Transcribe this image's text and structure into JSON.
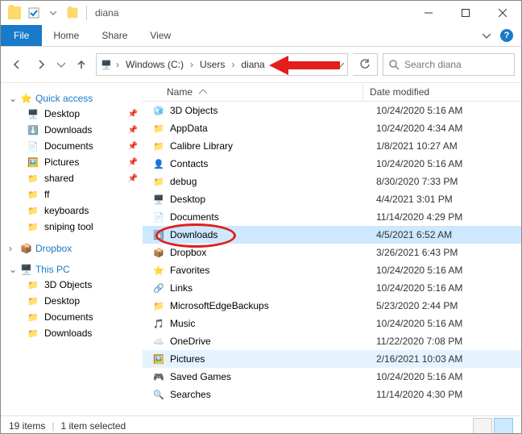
{
  "titlebar": {
    "title": "diana"
  },
  "ribbon": {
    "file": "File",
    "tabs": [
      "Home",
      "Share",
      "View"
    ]
  },
  "breadcrumbs": [
    "Windows (C:)",
    "Users",
    "diana"
  ],
  "search": {
    "placeholder": "Search diana"
  },
  "sidebar": {
    "quick_access": {
      "label": "Quick access",
      "items": [
        {
          "label": "Desktop",
          "pinned": true,
          "icon": "desktop"
        },
        {
          "label": "Downloads",
          "pinned": true,
          "icon": "downloads"
        },
        {
          "label": "Documents",
          "pinned": true,
          "icon": "documents"
        },
        {
          "label": "Pictures",
          "pinned": true,
          "icon": "pictures"
        },
        {
          "label": "shared",
          "pinned": true,
          "icon": "folder"
        },
        {
          "label": "ff",
          "pinned": false,
          "icon": "folder"
        },
        {
          "label": "keyboards",
          "pinned": false,
          "icon": "folder"
        },
        {
          "label": "sniping tool",
          "pinned": false,
          "icon": "folder"
        }
      ]
    },
    "dropbox": {
      "label": "Dropbox"
    },
    "this_pc": {
      "label": "This PC",
      "items": [
        {
          "label": "3D Objects"
        },
        {
          "label": "Desktop"
        },
        {
          "label": "Documents"
        },
        {
          "label": "Downloads"
        }
      ]
    }
  },
  "columns": {
    "name": "Name",
    "date": "Date modified"
  },
  "files": [
    {
      "name": "3D Objects",
      "date": "10/24/2020 5:16 AM",
      "icon": "3d"
    },
    {
      "name": "AppData",
      "date": "10/24/2020 4:34 AM",
      "icon": "folder"
    },
    {
      "name": "Calibre Library",
      "date": "1/8/2021 10:27 AM",
      "icon": "folder"
    },
    {
      "name": "Contacts",
      "date": "10/24/2020 5:16 AM",
      "icon": "contacts"
    },
    {
      "name": "debug",
      "date": "8/30/2020 7:33 PM",
      "icon": "folder"
    },
    {
      "name": "Desktop",
      "date": "4/4/2021 3:01 PM",
      "icon": "desktop"
    },
    {
      "name": "Documents",
      "date": "11/14/2020 4:29 PM",
      "icon": "documents"
    },
    {
      "name": "Downloads",
      "date": "4/5/2021 6:52 AM",
      "icon": "downloads",
      "selected": true
    },
    {
      "name": "Dropbox",
      "date": "3/26/2021 6:43 PM",
      "icon": "dropbox"
    },
    {
      "name": "Favorites",
      "date": "10/24/2020 5:16 AM",
      "icon": "favorites"
    },
    {
      "name": "Links",
      "date": "10/24/2020 5:16 AM",
      "icon": "links"
    },
    {
      "name": "MicrosoftEdgeBackups",
      "date": "5/23/2020 2:44 PM",
      "icon": "folder"
    },
    {
      "name": "Music",
      "date": "10/24/2020 5:16 AM",
      "icon": "music"
    },
    {
      "name": "OneDrive",
      "date": "11/22/2020 7:08 PM",
      "icon": "onedrive"
    },
    {
      "name": "Pictures",
      "date": "2/16/2021 10:03 AM",
      "icon": "pictures",
      "highlight": true
    },
    {
      "name": "Saved Games",
      "date": "10/24/2020 5:16 AM",
      "icon": "games"
    },
    {
      "name": "Searches",
      "date": "11/14/2020 4:30 PM",
      "icon": "searches"
    }
  ],
  "status": {
    "items": "19 items",
    "selected": "1 item selected"
  }
}
